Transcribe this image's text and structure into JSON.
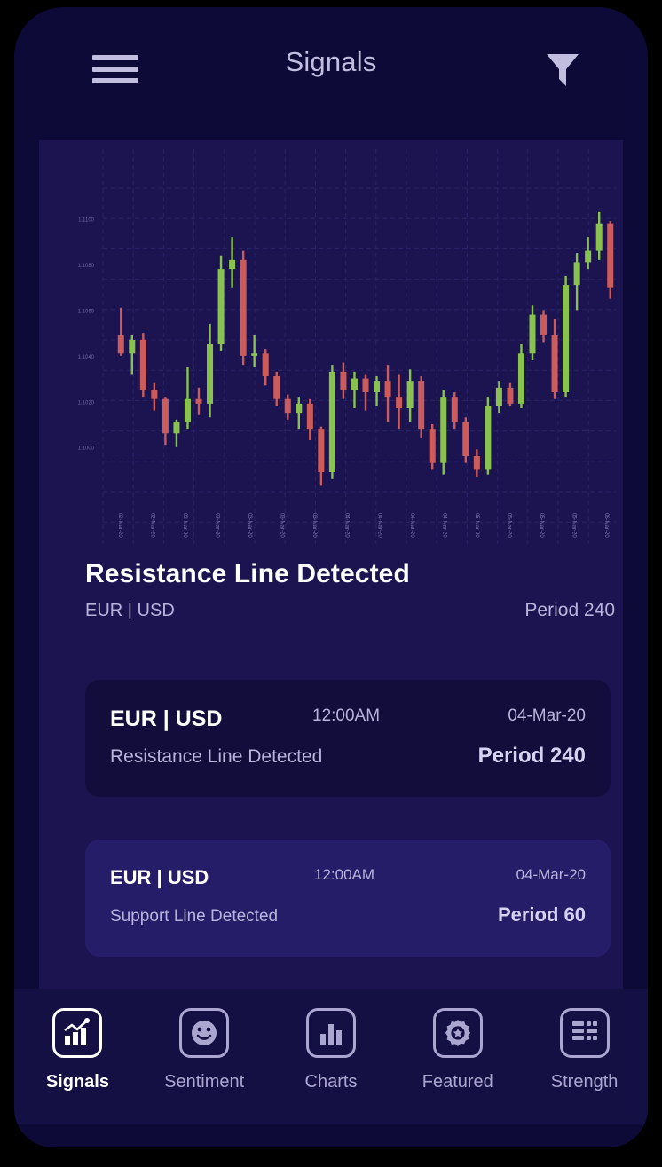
{
  "header": {
    "title": "Signals",
    "menu_icon": "hamburger-menu-icon",
    "filter_icon": "filter-funnel-icon"
  },
  "signal_headline": {
    "title": "Resistance Line Detected",
    "pair": "EUR | USD",
    "period": "Period 240"
  },
  "signal_cards": [
    {
      "pair": "EUR | USD",
      "time": "12:00AM",
      "date": "04-Mar-20",
      "description": "Resistance Line Detected",
      "period": "Period 240",
      "style": "variant-dark"
    },
    {
      "pair": "EUR | USD",
      "time": "12:00AM",
      "date": "04-Mar-20",
      "description": "Support Line Detected",
      "period": "Period 60",
      "style": "variant-light"
    }
  ],
  "bottom_nav": {
    "items": [
      {
        "label": "Signals",
        "icon": "line-bar-chart-icon",
        "active": true
      },
      {
        "label": "Sentiment",
        "icon": "smiley-face-icon",
        "active": false
      },
      {
        "label": "Charts",
        "icon": "bar-chart-icon",
        "active": false
      },
      {
        "label": "Featured",
        "icon": "badge-star-icon",
        "active": false
      },
      {
        "label": "Strength",
        "icon": "grid-table-icon",
        "active": false
      }
    ]
  },
  "colors": {
    "frame": "#0D0A38",
    "page_background": "#1B1450",
    "card_dark": "#120D3A",
    "card_light": "#261D68",
    "nav_background": "#151044",
    "accent_text": "#B9B4DC",
    "white": "#FFFFFF",
    "candle_up": "#8AC24F",
    "candle_down": "#CC5B5B",
    "grid": "#2B2369"
  },
  "chart_data": {
    "type": "candlestick",
    "title": "",
    "xlabel": "",
    "ylabel": "",
    "grid": true,
    "legend": null,
    "ylim": [
      1.0975,
      1.1115
    ],
    "ytick_labels": [
      "1.1100",
      "1.1080",
      "1.1060",
      "1.1040",
      "1.1020",
      "1.1000"
    ],
    "ytick_values": [
      1.11,
      1.108,
      1.106,
      1.104,
      1.102,
      1.1
    ],
    "xtick_labels": [
      "02-Mar-20",
      "02-Mar-20",
      "02-Mar-20",
      "03-Mar-20",
      "03-Mar-20",
      "03-Mar-20",
      "03-Mar-20",
      "04-Mar-20",
      "04-Mar-20",
      "04-Mar-20",
      "04-Mar-20",
      "05-Mar-20",
      "05-Mar-20",
      "05-Mar-20",
      "05-Mar-20",
      "06-Mar-20"
    ],
    "ohlc": [
      {
        "o": 1.1049,
        "h": 1.1061,
        "l": 1.104,
        "c": 1.1041,
        "dir": "down"
      },
      {
        "o": 1.1041,
        "h": 1.1049,
        "l": 1.1032,
        "c": 1.1047,
        "dir": "up"
      },
      {
        "o": 1.1047,
        "h": 1.105,
        "l": 1.1022,
        "c": 1.1025,
        "dir": "down"
      },
      {
        "o": 1.1025,
        "h": 1.1028,
        "l": 1.1016,
        "c": 1.1021,
        "dir": "down"
      },
      {
        "o": 1.1021,
        "h": 1.1022,
        "l": 1.1001,
        "c": 1.1006,
        "dir": "down"
      },
      {
        "o": 1.1006,
        "h": 1.1012,
        "l": 1.1,
        "c": 1.1011,
        "dir": "up"
      },
      {
        "o": 1.1011,
        "h": 1.1035,
        "l": 1.1008,
        "c": 1.1021,
        "dir": "up"
      },
      {
        "o": 1.1021,
        "h": 1.1026,
        "l": 1.1014,
        "c": 1.1019,
        "dir": "down"
      },
      {
        "o": 1.1019,
        "h": 1.1054,
        "l": 1.1013,
        "c": 1.1045,
        "dir": "up"
      },
      {
        "o": 1.1045,
        "h": 1.1084,
        "l": 1.1042,
        "c": 1.1078,
        "dir": "up"
      },
      {
        "o": 1.1078,
        "h": 1.1092,
        "l": 1.107,
        "c": 1.1082,
        "dir": "up"
      },
      {
        "o": 1.1082,
        "h": 1.1086,
        "l": 1.1036,
        "c": 1.104,
        "dir": "down"
      },
      {
        "o": 1.104,
        "h": 1.1049,
        "l": 1.1035,
        "c": 1.1041,
        "dir": "up"
      },
      {
        "o": 1.1041,
        "h": 1.1043,
        "l": 1.1027,
        "c": 1.1031,
        "dir": "down"
      },
      {
        "o": 1.1031,
        "h": 1.1033,
        "l": 1.1018,
        "c": 1.1021,
        "dir": "down"
      },
      {
        "o": 1.1021,
        "h": 1.1023,
        "l": 1.1012,
        "c": 1.1015,
        "dir": "down"
      },
      {
        "o": 1.1015,
        "h": 1.1022,
        "l": 1.1008,
        "c": 1.1019,
        "dir": "up"
      },
      {
        "o": 1.1019,
        "h": 1.1021,
        "l": 1.1003,
        "c": 1.1008,
        "dir": "down"
      },
      {
        "o": 1.1008,
        "h": 1.1009,
        "l": 1.0983,
        "c": 1.0989,
        "dir": "down"
      },
      {
        "o": 1.0989,
        "h": 1.1036,
        "l": 1.0986,
        "c": 1.1033,
        "dir": "up"
      },
      {
        "o": 1.1033,
        "h": 1.1037,
        "l": 1.1021,
        "c": 1.1025,
        "dir": "down"
      },
      {
        "o": 1.1025,
        "h": 1.1033,
        "l": 1.1017,
        "c": 1.103,
        "dir": "up"
      },
      {
        "o": 1.103,
        "h": 1.1032,
        "l": 1.1016,
        "c": 1.1024,
        "dir": "down"
      },
      {
        "o": 1.1024,
        "h": 1.1031,
        "l": 1.1018,
        "c": 1.1029,
        "dir": "up"
      },
      {
        "o": 1.1029,
        "h": 1.1036,
        "l": 1.1011,
        "c": 1.1022,
        "dir": "down"
      },
      {
        "o": 1.1022,
        "h": 1.1032,
        "l": 1.1008,
        "c": 1.1017,
        "dir": "down"
      },
      {
        "o": 1.1017,
        "h": 1.1034,
        "l": 1.1011,
        "c": 1.1029,
        "dir": "up"
      },
      {
        "o": 1.1029,
        "h": 1.1031,
        "l": 1.1004,
        "c": 1.1008,
        "dir": "down"
      },
      {
        "o": 1.1008,
        "h": 1.101,
        "l": 1.099,
        "c": 1.0993,
        "dir": "down"
      },
      {
        "o": 1.0993,
        "h": 1.1025,
        "l": 1.0988,
        "c": 1.1022,
        "dir": "up"
      },
      {
        "o": 1.1022,
        "h": 1.1024,
        "l": 1.1008,
        "c": 1.1011,
        "dir": "down"
      },
      {
        "o": 1.1011,
        "h": 1.1013,
        "l": 1.0993,
        "c": 1.0996,
        "dir": "down"
      },
      {
        "o": 1.0996,
        "h": 1.0999,
        "l": 1.0987,
        "c": 1.099,
        "dir": "down"
      },
      {
        "o": 1.099,
        "h": 1.1022,
        "l": 1.0988,
        "c": 1.1018,
        "dir": "up"
      },
      {
        "o": 1.1018,
        "h": 1.1029,
        "l": 1.1015,
        "c": 1.1026,
        "dir": "up"
      },
      {
        "o": 1.1026,
        "h": 1.1028,
        "l": 1.1018,
        "c": 1.1019,
        "dir": "down"
      },
      {
        "o": 1.1019,
        "h": 1.1045,
        "l": 1.1017,
        "c": 1.1041,
        "dir": "up"
      },
      {
        "o": 1.1041,
        "h": 1.1062,
        "l": 1.1038,
        "c": 1.1058,
        "dir": "up"
      },
      {
        "o": 1.1058,
        "h": 1.106,
        "l": 1.1046,
        "c": 1.1049,
        "dir": "down"
      },
      {
        "o": 1.1049,
        "h": 1.1056,
        "l": 1.1021,
        "c": 1.1024,
        "dir": "down"
      },
      {
        "o": 1.1024,
        "h": 1.1075,
        "l": 1.1022,
        "c": 1.1071,
        "dir": "up"
      },
      {
        "o": 1.1071,
        "h": 1.1085,
        "l": 1.106,
        "c": 1.1081,
        "dir": "up"
      },
      {
        "o": 1.1081,
        "h": 1.1092,
        "l": 1.1078,
        "c": 1.1086,
        "dir": "up"
      },
      {
        "o": 1.1086,
        "h": 1.1103,
        "l": 1.1082,
        "c": 1.1098,
        "dir": "up"
      },
      {
        "o": 1.1098,
        "h": 1.1099,
        "l": 1.1065,
        "c": 1.107,
        "dir": "down"
      }
    ]
  }
}
